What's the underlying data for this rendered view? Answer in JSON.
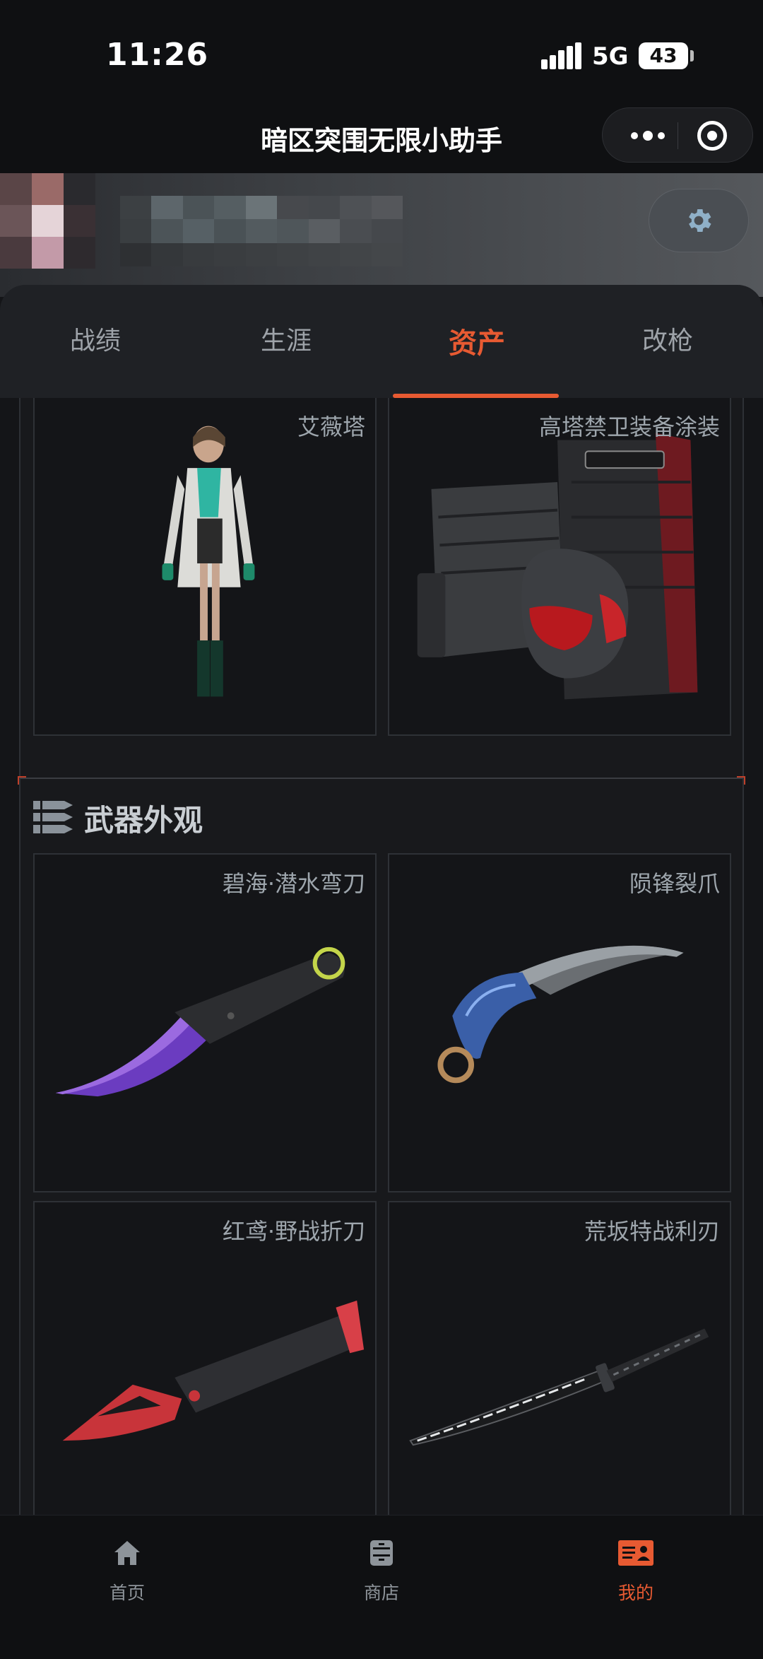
{
  "status_bar": {
    "time": "11:26",
    "network": "5G",
    "battery": "43"
  },
  "header": {
    "title": "暗区突围无限小助手"
  },
  "tabs": [
    {
      "label": "战绩"
    },
    {
      "label": "生涯"
    },
    {
      "label": "资产"
    },
    {
      "label": "改枪"
    }
  ],
  "active_tab": "资产",
  "cosmetics": [
    {
      "name": "艾薇塔"
    },
    {
      "name": "高塔禁卫装备涂装"
    }
  ],
  "weapons_section": {
    "title": "武器外观",
    "items": [
      {
        "name": "碧海·潜水弯刀"
      },
      {
        "name": "陨锋裂爪"
      },
      {
        "name": "红鸢·野战折刀"
      },
      {
        "name": "荒坂特战利刃"
      }
    ]
  },
  "bottom_nav": [
    {
      "label": "首页",
      "icon": "home-icon"
    },
    {
      "label": "商店",
      "icon": "store-icon"
    },
    {
      "label": "我的",
      "icon": "profile-card-icon"
    }
  ],
  "colors": {
    "accent": "#e75a32",
    "background": "#141518",
    "card": "#18191c"
  }
}
